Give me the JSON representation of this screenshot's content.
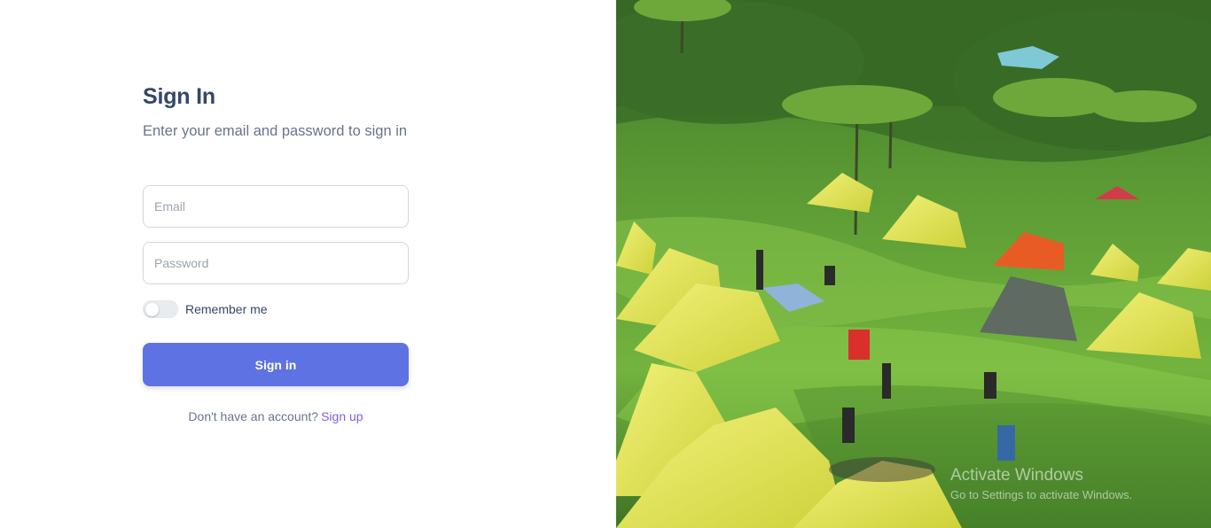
{
  "signin": {
    "title": "Sign In",
    "subtitle": "Enter your email and password to sign in",
    "email_placeholder": "Email",
    "password_placeholder": "Password",
    "remember_label": "Remember me",
    "remember_checked": false,
    "button_label": "Sign in",
    "no_account_text": "Don't have an account?",
    "signup_link": "Sign up"
  },
  "colors": {
    "primary": "#5e72e4",
    "heading": "#344767",
    "text": "#67748e",
    "link": "#825ee4"
  },
  "watermark": {
    "title": "Activate Windows",
    "subtitle": "Go to Settings to activate Windows."
  }
}
